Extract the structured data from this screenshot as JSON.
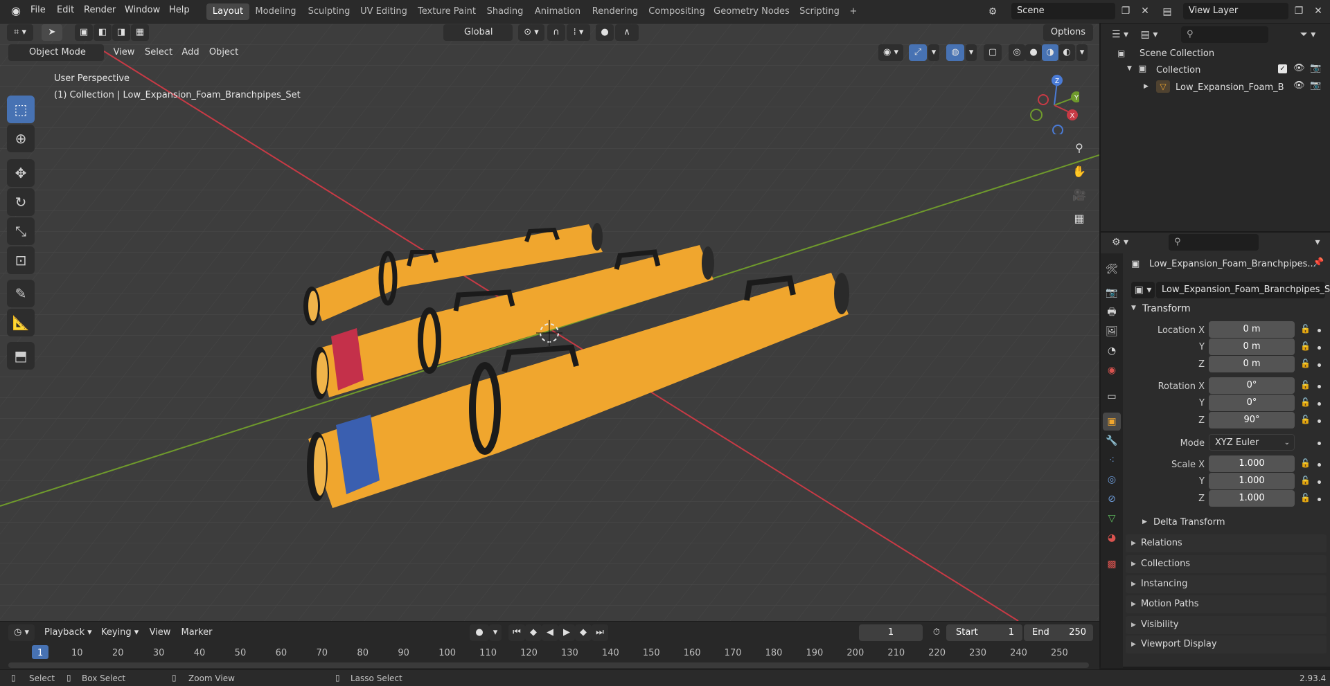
{
  "topbar": {
    "menus": [
      "File",
      "Edit",
      "Render",
      "Window",
      "Help"
    ],
    "workspaces": [
      "Layout",
      "Modeling",
      "Sculpting",
      "UV Editing",
      "Texture Paint",
      "Shading",
      "Animation",
      "Rendering",
      "Compositing",
      "Geometry Nodes",
      "Scripting"
    ],
    "active_workspace": "Layout",
    "add_tab": "+",
    "scene": "Scene",
    "view_layer": "View Layer"
  },
  "viewport": {
    "transform_orientation": "Global",
    "options": "Options",
    "mode": "Object Mode",
    "menus": [
      "View",
      "Select",
      "Add",
      "Object"
    ],
    "info_line1": "User Perspective",
    "info_line2": "(1) Collection | Low_Expansion_Foam_Branchpipes_Set",
    "gizmo": {
      "z": "Z",
      "y": "Y",
      "x": "X"
    },
    "colors": {
      "bg": "#3d3d3d",
      "object": "#f0a62e",
      "x_axis": "#c83a45",
      "y_axis": "#6f9a2c",
      "blue_stripe": "#3a5fb0",
      "red_stripe": "#c4304a"
    }
  },
  "outliner": {
    "scene_collection": "Scene Collection",
    "collection": "Collection",
    "object": "Low_Expansion_Foam_B"
  },
  "properties": {
    "object_name": "Low_Expansion_Foam_Branchpipes...",
    "data_name": "Low_Expansion_Foam_Branchpipes_Set",
    "transform": "Transform",
    "location_label": "Location X",
    "y": "Y",
    "z": "Z",
    "location": [
      "0 m",
      "0 m",
      "0 m"
    ],
    "rotation_label": "Rotation X",
    "rotation": [
      "0°",
      "0°",
      "90°"
    ],
    "mode_label": "Mode",
    "mode_value": "XYZ Euler",
    "scale_label": "Scale X",
    "scale": [
      "1.000",
      "1.000",
      "1.000"
    ],
    "delta": "Delta Transform",
    "sections": [
      "Relations",
      "Collections",
      "Instancing",
      "Motion Paths",
      "Visibility",
      "Viewport Display"
    ]
  },
  "timeline": {
    "playback": "Playback",
    "keying": "Keying",
    "view": "View",
    "marker": "Marker",
    "current_frame": "1",
    "start_label": "Start",
    "start": "1",
    "end_label": "End",
    "end": "250",
    "ticks": [
      "1",
      "10",
      "20",
      "30",
      "40",
      "50",
      "60",
      "70",
      "80",
      "90",
      "100",
      "110",
      "120",
      "130",
      "140",
      "150",
      "160",
      "170",
      "180",
      "190",
      "200",
      "210",
      "220",
      "230",
      "240",
      "250"
    ]
  },
  "status": {
    "select": "Select",
    "box_select": "Box Select",
    "zoom_view": "Zoom View",
    "lasso_select": "Lasso Select",
    "version": "2.93.4"
  }
}
